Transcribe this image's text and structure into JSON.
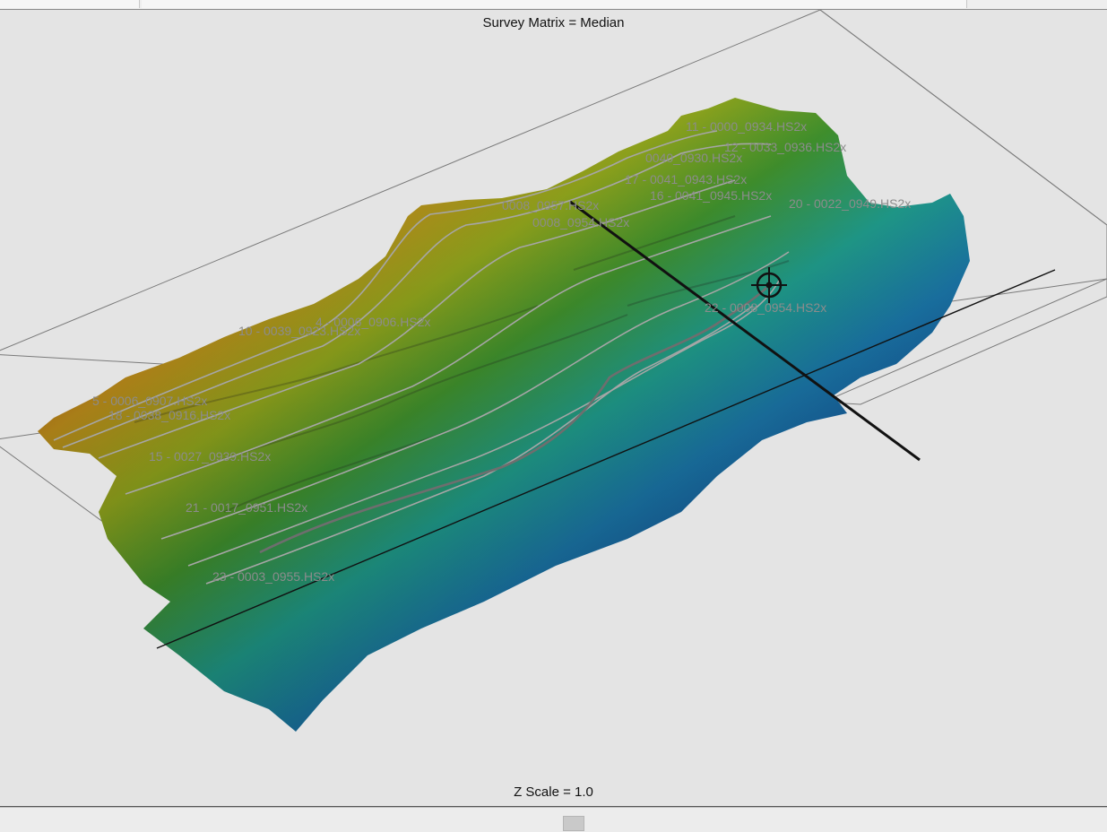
{
  "viewport": {
    "title": "Survey Matrix = Median",
    "z_scale_label": "Z Scale = 1.0"
  },
  "survey_lines": [
    {
      "label": "11 - 0000_0934.HS2x"
    },
    {
      "label": "12 - 0033_0936.HS2x"
    },
    {
      "label": "0040_0930.HS2x"
    },
    {
      "label": "17 - 0041_0943.HS2x"
    },
    {
      "label": "16 - 0041_0945.HS2x"
    },
    {
      "label": "20 - 0022_0949.HS2x"
    },
    {
      "label": "0008_0957.HS2x"
    },
    {
      "label": "0008_0954.HS2x"
    },
    {
      "label": "22 - 0008_0954.HS2x"
    },
    {
      "label": "10 - 0039_0923.HS2x"
    },
    {
      "label": "4 - 0006_0906.HS2x"
    },
    {
      "label": "5 - 0006_0907.HS2x"
    },
    {
      "label": "18 - 0038_0916.HS2x"
    },
    {
      "label": "15 - 0027_0939.HS2x"
    },
    {
      "label": "21 - 0017_0951.HS2x"
    },
    {
      "label": "23 - 0003_0955.HS2x"
    }
  ],
  "colors": {
    "deep": "#0a1560",
    "shallow": "#7a1208",
    "track": "#9a9a9a"
  },
  "icons": {
    "cursor": "crosshair-target-icon"
  }
}
